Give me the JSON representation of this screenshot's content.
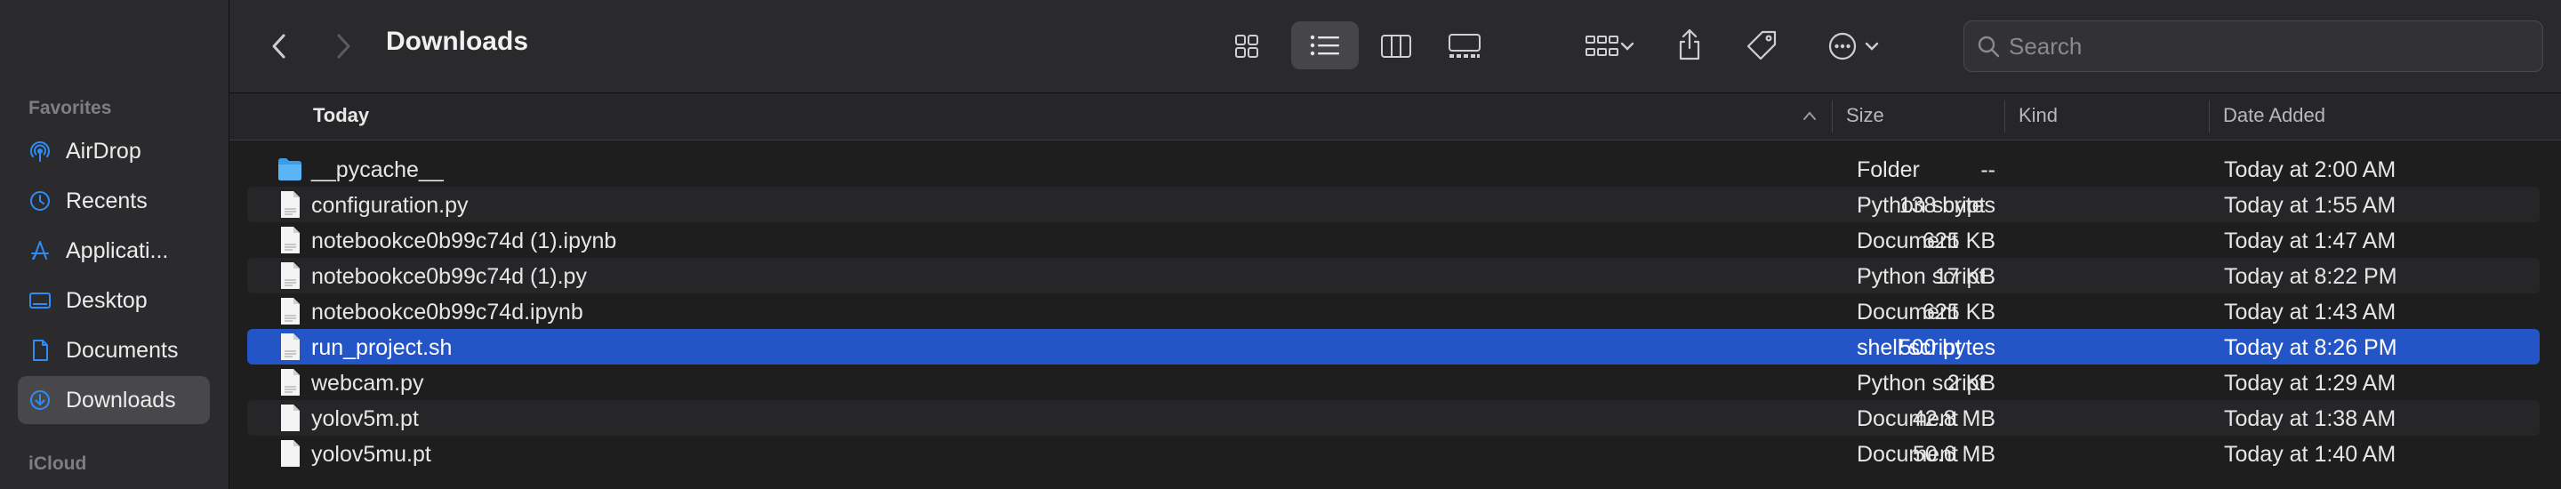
{
  "sidebar": {
    "favorites_title": "Favorites",
    "icloud_title": "iCloud",
    "items": [
      {
        "label": "AirDrop",
        "icon": "airdrop-icon"
      },
      {
        "label": "Recents",
        "icon": "clock-icon"
      },
      {
        "label": "Applicati...",
        "icon": "applications-icon"
      },
      {
        "label": "Desktop",
        "icon": "desktop-icon"
      },
      {
        "label": "Documents",
        "icon": "document-icon"
      },
      {
        "label": "Downloads",
        "icon": "download-icon",
        "active": true
      }
    ]
  },
  "toolbar": {
    "title": "Downloads",
    "search_placeholder": "Search"
  },
  "header": {
    "name": "Today",
    "size": "Size",
    "kind": "Kind",
    "date_added": "Date Added"
  },
  "files": [
    {
      "name": "__pycache__",
      "size": "--",
      "kind": "Folder",
      "date": "Today at 2:00 AM",
      "type": "folder"
    },
    {
      "name": "configuration.py",
      "size": "138 bytes",
      "kind": "Python script",
      "date": "Today at 1:55 AM",
      "type": "file"
    },
    {
      "name": "notebookce0b99c74d (1).ipynb",
      "size": "625 KB",
      "kind": "Document",
      "date": "Today at 1:47 AM",
      "type": "file"
    },
    {
      "name": "notebookce0b99c74d (1).py",
      "size": "17 KB",
      "kind": "Python script",
      "date": "Today at 8:22 PM",
      "type": "file"
    },
    {
      "name": "notebookce0b99c74d.ipynb",
      "size": "625 KB",
      "kind": "Document",
      "date": "Today at 1:43 AM",
      "type": "file"
    },
    {
      "name": "run_project.sh",
      "size": "500 bytes",
      "kind": "shell script",
      "date": "Today at 8:26 PM",
      "type": "file",
      "selected": true
    },
    {
      "name": "webcam.py",
      "size": "2 KB",
      "kind": "Python script",
      "date": "Today at 1:29 AM",
      "type": "file"
    },
    {
      "name": "yolov5m.pt",
      "size": "42.8 MB",
      "kind": "Document",
      "date": "Today at 1:38 AM",
      "type": "file"
    },
    {
      "name": "yolov5mu.pt",
      "size": "50.6 MB",
      "kind": "Document",
      "date": "Today at 1:40 AM",
      "type": "file"
    }
  ],
  "colors": {
    "accent": "#2f8cf6",
    "selection": "#2455c6"
  }
}
